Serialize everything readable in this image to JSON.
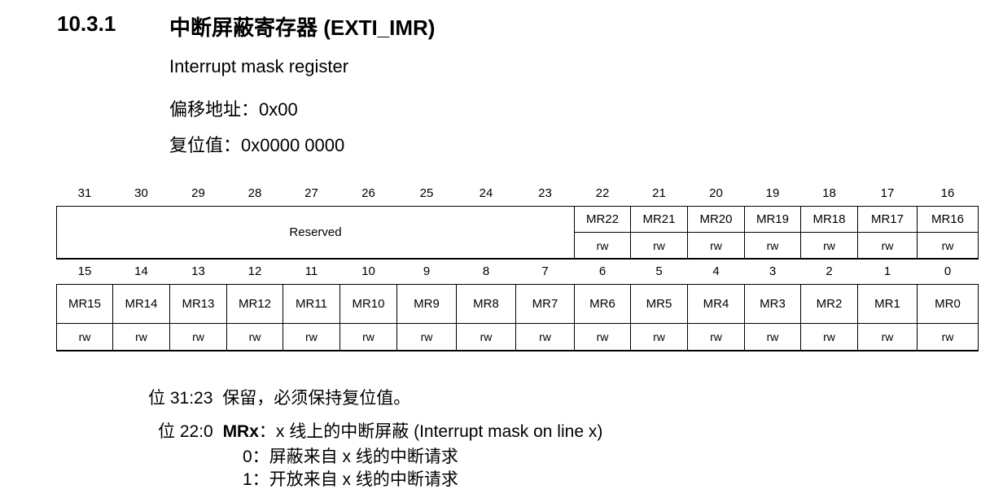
{
  "section": {
    "number": "10.3.1",
    "title": "中断屏蔽寄存器 (EXTI_IMR)"
  },
  "register": {
    "name": "Interrupt mask register",
    "offset": "偏移地址：0x00",
    "reset": "复位值：0x0000 0000"
  },
  "upper": {
    "bits": [
      "31",
      "30",
      "29",
      "28",
      "27",
      "26",
      "25",
      "24",
      "23",
      "22",
      "21",
      "20",
      "19",
      "18",
      "17",
      "16"
    ],
    "reserved_label": "Reserved",
    "fields": [
      "MR22",
      "MR21",
      "MR20",
      "MR19",
      "MR18",
      "MR17",
      "MR16"
    ],
    "access": [
      "rw",
      "rw",
      "rw",
      "rw",
      "rw",
      "rw",
      "rw"
    ]
  },
  "lower": {
    "bits": [
      "15",
      "14",
      "13",
      "12",
      "11",
      "10",
      "9",
      "8",
      "7",
      "6",
      "5",
      "4",
      "3",
      "2",
      "1",
      "0"
    ],
    "fields": [
      "MR15",
      "MR14",
      "MR13",
      "MR12",
      "MR11",
      "MR10",
      "MR9",
      "MR8",
      "MR7",
      "MR6",
      "MR5",
      "MR4",
      "MR3",
      "MR2",
      "MR1",
      "MR0"
    ],
    "access": [
      "rw",
      "rw",
      "rw",
      "rw",
      "rw",
      "rw",
      "rw",
      "rw",
      "rw",
      "rw",
      "rw",
      "rw",
      "rw",
      "rw",
      "rw",
      "rw"
    ]
  },
  "description": {
    "bits_31_23_label": "位 31:23",
    "bits_31_23_text": "保留，必须保持复位值。",
    "bits_22_0_label": "位 22:0",
    "bits_22_0_field": "MRx",
    "bits_22_0_text": "：x 线上的中断屏蔽 (Interrupt mask on line x)",
    "value0": "0：屏蔽来自 x 线的中断请求",
    "value1": "1：开放来自 x 线的中断请求"
  }
}
